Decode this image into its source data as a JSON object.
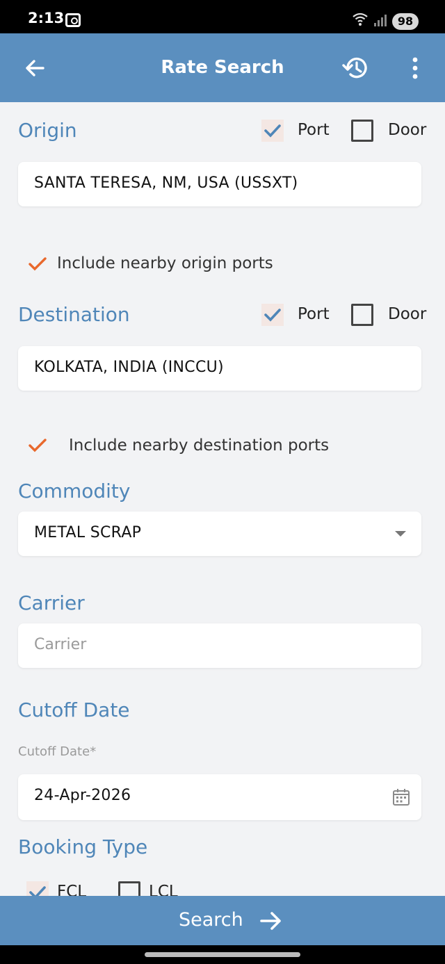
{
  "status": {
    "time": "2:13",
    "battery": "98"
  },
  "appbar": {
    "title": "Rate Search"
  },
  "origin": {
    "title": "Origin",
    "port_label": "Port",
    "door_label": "Door",
    "value": "SANTA TERESA, NM, USA (USSXT)",
    "nearby_label": "Include nearby origin ports"
  },
  "destination": {
    "title": "Destination",
    "port_label": "Port",
    "door_label": "Door",
    "value": "KOLKATA, INDIA (INCCU)",
    "nearby_label": "Include nearby destination ports"
  },
  "commodity": {
    "title": "Commodity",
    "value": "METAL SCRAP"
  },
  "carrier": {
    "title": "Carrier",
    "placeholder": "Carrier"
  },
  "cutoff": {
    "title": "Cutoff Date",
    "field_label": "Cutoff Date*",
    "value": "24-Apr-2026"
  },
  "booking": {
    "title": "Booking Type",
    "fcl_label": "FCL",
    "lcl_label": "LCL"
  },
  "search": {
    "label": "Search"
  },
  "colors": {
    "accent": "#5b8fbf",
    "heading": "#4f86b8",
    "check_orange": "#e8682c"
  },
  "icons": [
    "back-arrow-icon",
    "history-icon",
    "more-vert-icon",
    "check-icon",
    "calendar-icon",
    "dropdown-caret-icon",
    "arrow-right-icon"
  ]
}
